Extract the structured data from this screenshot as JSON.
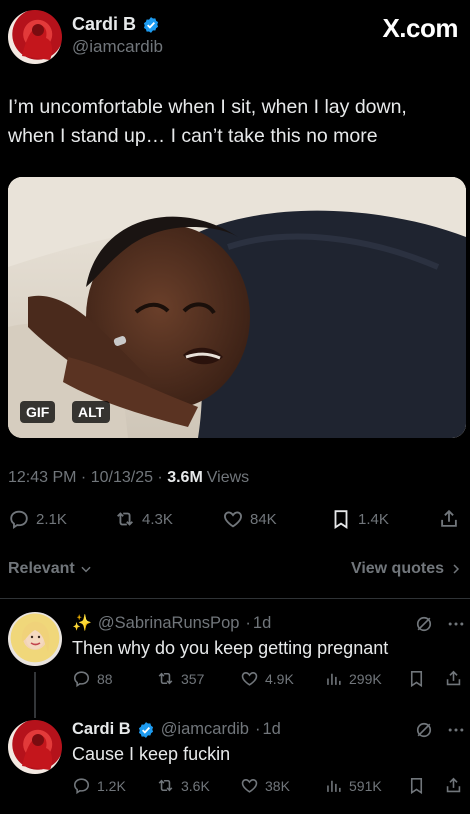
{
  "header": {
    "display_name": "Cardi B",
    "handle": "@iamcardib",
    "watermark": "X.com",
    "verified_color": "#1d9bf0"
  },
  "tweet": {
    "text_line1": "I’m uncomfortable when I sit, when I lay down,",
    "text_line2": "when I stand up… I can’t take this no more",
    "media": {
      "badge_gif": "GIF",
      "badge_alt": "ALT"
    },
    "time": "12:43 PM",
    "date": "10/13/25",
    "views_count": "3.6M",
    "views_label": "Views",
    "replies": "2.1K",
    "reposts": "4.3K",
    "likes": "84K",
    "bookmarks": "1.4K"
  },
  "filter": {
    "sort_label": "Relevant",
    "view_quotes_label": "View quotes"
  },
  "replies": [
    {
      "sparkle": "✨",
      "handle": "@SabrinaRunsPop",
      "age": "1d",
      "text": "Then why do you keep getting pregnant",
      "replies": "88",
      "reposts": "357",
      "likes": "4.9K",
      "views": "299K"
    },
    {
      "display_name": "Cardi B",
      "handle": "@iamcardib",
      "age": "1d",
      "text": "Cause I keep fuckin",
      "replies": "1.2K",
      "reposts": "3.6K",
      "likes": "38K",
      "views": "591K"
    }
  ],
  "icons": [
    "verified-badge-icon",
    "reply-icon",
    "repost-icon",
    "like-icon",
    "bookmark-icon",
    "share-icon",
    "views-icon",
    "grok-icon",
    "more-icon",
    "chevron-down-icon",
    "chevron-right-icon",
    "sparkles-icon"
  ]
}
